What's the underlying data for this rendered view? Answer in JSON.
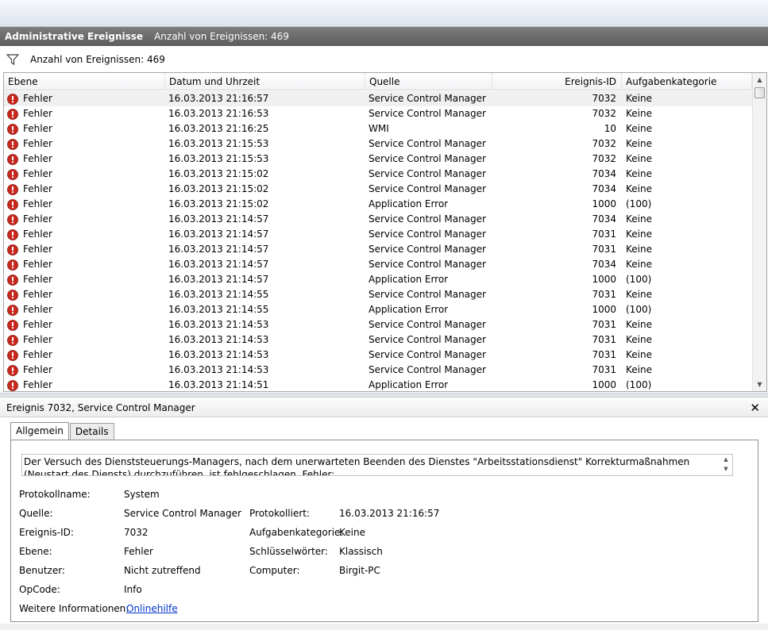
{
  "header": {
    "title": "Administrative Ereignisse",
    "count_label": "Anzahl von Ereignissen: 469"
  },
  "filter": {
    "label": "Anzahl von Ereignissen: 469",
    "icon": "filter-icon"
  },
  "grid": {
    "columns": [
      "Ebene",
      "Datum und Uhrzeit",
      "Quelle",
      "Ereignis-ID",
      "Aufgabenkategorie"
    ],
    "level_icon": "error-icon",
    "error_color": "#c8281e",
    "rows": [
      {
        "level": "Fehler",
        "datetime": "16.03.2013 21:16:57",
        "source": "Service Control Manager",
        "id": "7032",
        "category": "Keine"
      },
      {
        "level": "Fehler",
        "datetime": "16.03.2013 21:16:53",
        "source": "Service Control Manager",
        "id": "7032",
        "category": "Keine"
      },
      {
        "level": "Fehler",
        "datetime": "16.03.2013 21:16:25",
        "source": "WMI",
        "id": "10",
        "category": "Keine"
      },
      {
        "level": "Fehler",
        "datetime": "16.03.2013 21:15:53",
        "source": "Service Control Manager",
        "id": "7032",
        "category": "Keine"
      },
      {
        "level": "Fehler",
        "datetime": "16.03.2013 21:15:53",
        "source": "Service Control Manager",
        "id": "7032",
        "category": "Keine"
      },
      {
        "level": "Fehler",
        "datetime": "16.03.2013 21:15:02",
        "source": "Service Control Manager",
        "id": "7034",
        "category": "Keine"
      },
      {
        "level": "Fehler",
        "datetime": "16.03.2013 21:15:02",
        "source": "Service Control Manager",
        "id": "7034",
        "category": "Keine"
      },
      {
        "level": "Fehler",
        "datetime": "16.03.2013 21:15:02",
        "source": "Application Error",
        "id": "1000",
        "category": "(100)"
      },
      {
        "level": "Fehler",
        "datetime": "16.03.2013 21:14:57",
        "source": "Service Control Manager",
        "id": "7034",
        "category": "Keine"
      },
      {
        "level": "Fehler",
        "datetime": "16.03.2013 21:14:57",
        "source": "Service Control Manager",
        "id": "7031",
        "category": "Keine"
      },
      {
        "level": "Fehler",
        "datetime": "16.03.2013 21:14:57",
        "source": "Service Control Manager",
        "id": "7031",
        "category": "Keine"
      },
      {
        "level": "Fehler",
        "datetime": "16.03.2013 21:14:57",
        "source": "Service Control Manager",
        "id": "7034",
        "category": "Keine"
      },
      {
        "level": "Fehler",
        "datetime": "16.03.2013 21:14:57",
        "source": "Application Error",
        "id": "1000",
        "category": "(100)"
      },
      {
        "level": "Fehler",
        "datetime": "16.03.2013 21:14:55",
        "source": "Service Control Manager",
        "id": "7031",
        "category": "Keine"
      },
      {
        "level": "Fehler",
        "datetime": "16.03.2013 21:14:55",
        "source": "Application Error",
        "id": "1000",
        "category": "(100)"
      },
      {
        "level": "Fehler",
        "datetime": "16.03.2013 21:14:53",
        "source": "Service Control Manager",
        "id": "7031",
        "category": "Keine"
      },
      {
        "level": "Fehler",
        "datetime": "16.03.2013 21:14:53",
        "source": "Service Control Manager",
        "id": "7031",
        "category": "Keine"
      },
      {
        "level": "Fehler",
        "datetime": "16.03.2013 21:14:53",
        "source": "Service Control Manager",
        "id": "7031",
        "category": "Keine"
      },
      {
        "level": "Fehler",
        "datetime": "16.03.2013 21:14:53",
        "source": "Service Control Manager",
        "id": "7031",
        "category": "Keine"
      },
      {
        "level": "Fehler",
        "datetime": "16.03.2013 21:14:51",
        "source": "Application Error",
        "id": "1000",
        "category": "(100)"
      }
    ]
  },
  "details": {
    "title": "Ereignis 7032, Service Control Manager",
    "tabs": [
      "Allgemein",
      "Details"
    ],
    "description": "Der Versuch des Dienststeuerungs-Managers, nach dem unerwarteten Beenden des Dienstes \"Arbeitsstationsdienst\" Korrekturmaßnahmen (Neustart des Diensts) durchzuführen, ist fehlgeschlagen. Fehler:",
    "props": {
      "protokollname_label": "Protokollname:",
      "protokollname": "System",
      "quelle_label": "Quelle:",
      "quelle": "Service Control Manager",
      "protokolliert_label": "Protokolliert:",
      "protokolliert": "16.03.2013 21:16:57",
      "ereignis_id_label": "Ereignis-ID:",
      "ereignis_id": "7032",
      "aufgabenkategorie_label": "Aufgabenkategorie:",
      "aufgabenkategorie": "Keine",
      "ebene_label": "Ebene:",
      "ebene": "Fehler",
      "schluesselwoerter_label": "Schlüsselwörter:",
      "schluesselwoerter": "Klassisch",
      "benutzer_label": "Benutzer:",
      "benutzer": "Nicht zutreffend",
      "computer_label": "Computer:",
      "computer": "Birgit-PC",
      "opcode_label": "OpCode:",
      "opcode": "Info",
      "weitere_label": "Weitere Informationen:",
      "weitere_link": "Onlinehilfe"
    }
  }
}
